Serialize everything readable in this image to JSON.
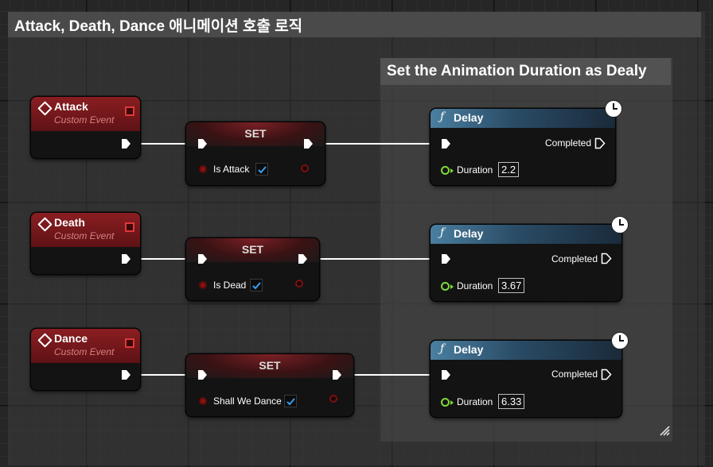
{
  "comments": {
    "outer_title": "Attack, Death, Dance 애니메이션 호출 로직",
    "inner_title": "Set the Animation Duration as Dealy"
  },
  "rows": [
    {
      "event_name": "Attack",
      "event_sub": "Custom Event",
      "set_label": "SET",
      "var_label": "Is Attack",
      "checked": true,
      "delay_title": "Delay",
      "completed_label": "Completed",
      "duration_label": "Duration",
      "duration_value": "2.2"
    },
    {
      "event_name": "Death",
      "event_sub": "Custom Event",
      "set_label": "SET",
      "var_label": "Is Dead",
      "checked": true,
      "delay_title": "Delay",
      "completed_label": "Completed",
      "duration_label": "Duration",
      "duration_value": "3.67"
    },
    {
      "event_name": "Dance",
      "event_sub": "Custom Event",
      "set_label": "SET",
      "var_label": "Shall We Dance",
      "checked": true,
      "delay_title": "Delay",
      "completed_label": "Completed",
      "duration_label": "Duration",
      "duration_value": "6.33"
    }
  ],
  "icons": {
    "event": "diamond-icon",
    "delegate": "delegate-pin-icon",
    "function": "function-icon",
    "latent": "clock-icon",
    "check": "checkmark-icon"
  },
  "colors": {
    "event_header": "#8a1e22",
    "delay_header": "#4a7fa0",
    "float_pin": "#7fd93a",
    "bool_pin": "#8c1010",
    "checkmark": "#3a9ef0"
  }
}
